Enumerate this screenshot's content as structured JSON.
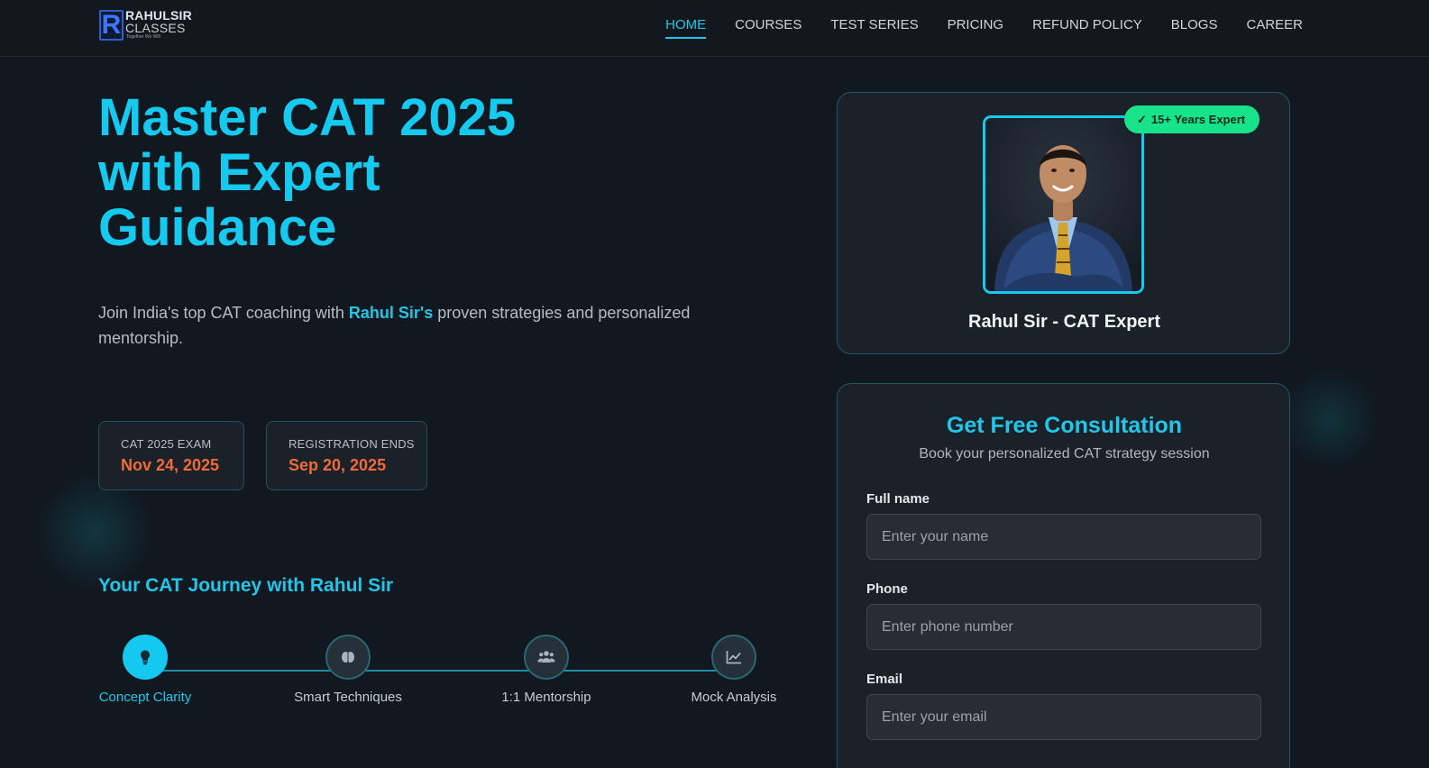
{
  "brand": {
    "logo_letter": "R",
    "line1": "RAHULSIR",
    "line2": "CLASSES",
    "tagline": "Together We Will"
  },
  "nav": {
    "items": [
      {
        "label": "HOME",
        "active": true
      },
      {
        "label": "COURSES",
        "active": false
      },
      {
        "label": "TEST SERIES",
        "active": false
      },
      {
        "label": "PRICING",
        "active": false
      },
      {
        "label": "REFUND POLICY",
        "active": false
      },
      {
        "label": "BLOGS",
        "active": false
      },
      {
        "label": "CAREER",
        "active": false
      }
    ]
  },
  "hero": {
    "title_lines": [
      "Master CAT 2025",
      "with Expert",
      "Guidance"
    ],
    "subtitle_before": "Join India's top CAT coaching with ",
    "subtitle_highlight": "Rahul Sir's",
    "subtitle_after": " proven strategies and personalized mentorship."
  },
  "dates": [
    {
      "label": "CAT 2025 EXAM",
      "value": "Nov 24, 2025"
    },
    {
      "label": "REGISTRATION ENDS",
      "value": "Sep 20, 2025"
    }
  ],
  "journey": {
    "title": "Your CAT Journey with Rahul Sir",
    "steps": [
      {
        "label": "Concept Clarity",
        "icon": "lightbulb-icon",
        "active": true
      },
      {
        "label": "Smart Techniques",
        "icon": "brain-icon",
        "active": false
      },
      {
        "label": "1:1 Mentorship",
        "icon": "users-icon",
        "active": false
      },
      {
        "label": "Mock Analysis",
        "icon": "chart-line-icon",
        "active": false
      }
    ]
  },
  "profile": {
    "badge": "15+ Years Expert",
    "name": "Rahul Sir - CAT Expert"
  },
  "consultation": {
    "title": "Get Free Consultation",
    "subtitle": "Book your personalized CAT strategy session",
    "fields": [
      {
        "label": "Full name",
        "placeholder": "Enter your name"
      },
      {
        "label": "Phone",
        "placeholder": "Enter phone number"
      },
      {
        "label": "Email",
        "placeholder": "Enter your email"
      }
    ]
  },
  "colors": {
    "accent": "#16c9ee",
    "date_value": "#f06a3a",
    "badge": "#19e38a",
    "background": "#111820"
  }
}
